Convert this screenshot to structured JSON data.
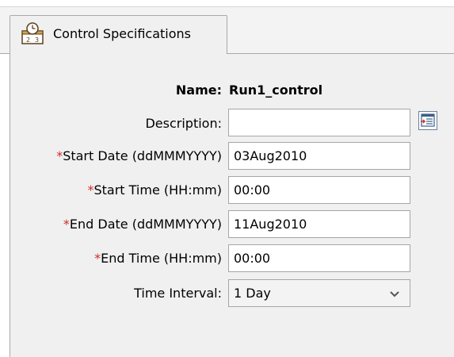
{
  "tab": {
    "label": "Control Specifications",
    "icon": "calendar-clock-icon"
  },
  "form": {
    "name_label": "Name:",
    "name_value": "Run1_control",
    "description": {
      "label": "Description:",
      "value": "",
      "button_icon": "description-editor-icon"
    },
    "start_date": {
      "required_mark": "*",
      "label": "Start Date (ddMMMYYYY)",
      "value": "03Aug2010"
    },
    "start_time": {
      "required_mark": "*",
      "label": "Start Time (HH:mm)",
      "value": "00:00"
    },
    "end_date": {
      "required_mark": "*",
      "label": "End Date (ddMMMYYYY)",
      "value": "11Aug2010"
    },
    "end_time": {
      "required_mark": "*",
      "label": "End Time (HH:mm)",
      "value": "00:00"
    },
    "time_interval": {
      "label": "Time Interval:",
      "value": "1 Day"
    }
  },
  "colors": {
    "required": "#d22b2b",
    "panel_bg": "#f0f0f0",
    "border": "#a6a6a6"
  }
}
